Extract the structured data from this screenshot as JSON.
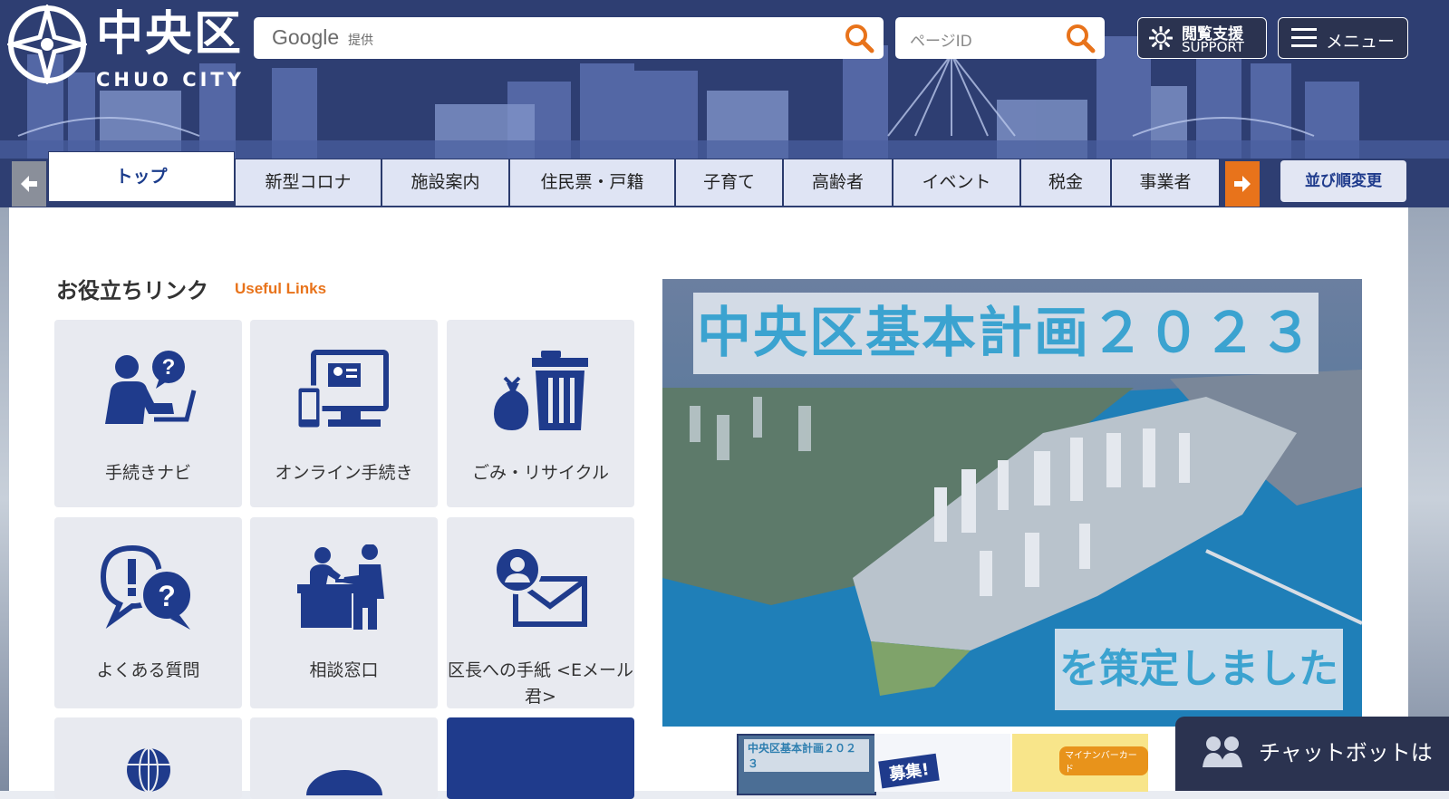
{
  "header": {
    "logo_jp": "中央区",
    "logo_en": "CHUO CITY",
    "search": {
      "google_text": "Google",
      "google_sub": "提供",
      "placeholder": ""
    },
    "page_id": {
      "placeholder": "ページID"
    },
    "support_button": {
      "line1": "閲覧支援",
      "line2": "SUPPORT",
      "icon": "gear-icon"
    },
    "menu_button": {
      "label": "メニュー",
      "icon": "hamburger-icon"
    }
  },
  "tabs": {
    "items": [
      "トップ",
      "新型コロナ",
      "施設案内",
      "住民票・戸籍",
      "子育て",
      "高齢者",
      "イベント",
      "税金",
      "事業者"
    ],
    "active_index": 0,
    "sort_button": "並び順変更"
  },
  "useful_links": {
    "title": "お役立ちリンク",
    "subtitle": "Useful Links",
    "items": [
      {
        "label": "手続きナビ",
        "icon": "person-question-laptop-icon"
      },
      {
        "label": "オンライン手続き",
        "icon": "monitor-phone-icon"
      },
      {
        "label": "ごみ・リサイクル",
        "icon": "trash-bin-icon"
      },
      {
        "label": "よくある質問",
        "icon": "faq-bubbles-icon"
      },
      {
        "label": "相談窓口",
        "icon": "consultation-desk-icon"
      },
      {
        "label": "区長への手紙 <Eメール君>",
        "icon": "mail-person-icon"
      },
      {
        "label": "",
        "icon": "globe-icon"
      },
      {
        "label": "",
        "icon": "circle-icon"
      },
      {
        "label": "",
        "icon": ""
      }
    ]
  },
  "banner": {
    "title": "中央区基本計画２０２３",
    "subtitle": "を策定しました"
  },
  "thumbnails": [
    {
      "text": "中央区基本計画２０２３"
    },
    {
      "text": "募集!"
    },
    {
      "text": "マイナンバーカード"
    }
  ],
  "chatbot": {
    "label": "チャットボットは"
  },
  "colors": {
    "navy": "#2e3e72",
    "tile_icon": "#1f3b8c",
    "accent_orange": "#e8731b",
    "tab_bg": "#dfe4f4"
  }
}
